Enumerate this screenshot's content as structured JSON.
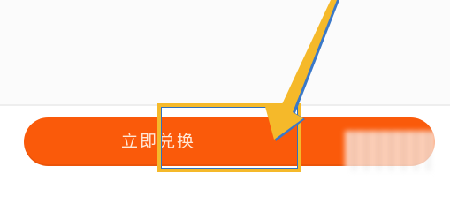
{
  "redeem_button": {
    "label": "立即兑换"
  },
  "colors": {
    "button": "#fa5a0a",
    "button_text": "#ffe7d6",
    "highlight": "#f5b92a",
    "arrow": "#f5b92a"
  },
  "icons": {
    "arrow": "annotation-arrow-icon"
  }
}
